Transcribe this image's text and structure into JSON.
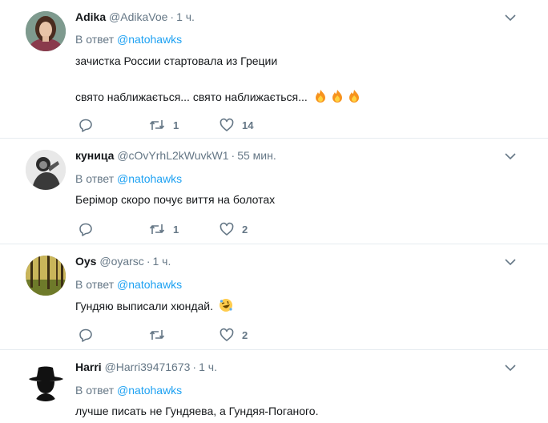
{
  "tweets": [
    {
      "name": "Adika",
      "handle": "@AdikaVoe",
      "time": "1 ч.",
      "reply_prefix": "В ответ",
      "mention": "@natohawks",
      "line1": "зачистка России стартовала из Греции",
      "line2": "свято наближається... свято наближається...",
      "emoji_line2": [
        "fire-emoji",
        "fire-emoji",
        "fire-emoji"
      ],
      "retweets": "1",
      "likes": "14",
      "avatar_icon": "woman-portrait-avatar"
    },
    {
      "name": "куница",
      "handle": "@cOvYrhL2kWuvkW1",
      "time": "55 мин.",
      "reply_prefix": "В ответ",
      "mention": "@natohawks",
      "line1": "Берімор скоро почує  виття  на болотах",
      "retweets": "1",
      "likes": "2",
      "avatar_icon": "monkey-bw-avatar"
    },
    {
      "name": "Oys",
      "handle": "@oyarsc",
      "time": "1 ч.",
      "reply_prefix": "В ответ",
      "mention": "@natohawks",
      "line1": "Гундяю выписали хюндай.",
      "emoji_line1": "rolling-laughing-emoji",
      "likes": "2",
      "avatar_icon": "forest-avatar"
    },
    {
      "name": "Harri",
      "handle": "@Harri39471673",
      "time": "1 ч.",
      "reply_prefix": "В ответ",
      "mention": "@natohawks",
      "line1": "лучше писать не Гундяева, а Гундяя-Поганого.",
      "avatar_icon": "spy-silhouette-avatar"
    }
  ],
  "colors": {
    "link": "#1da1f2",
    "muted": "#657786",
    "text": "#14171a",
    "divider": "#e6ecf0"
  }
}
